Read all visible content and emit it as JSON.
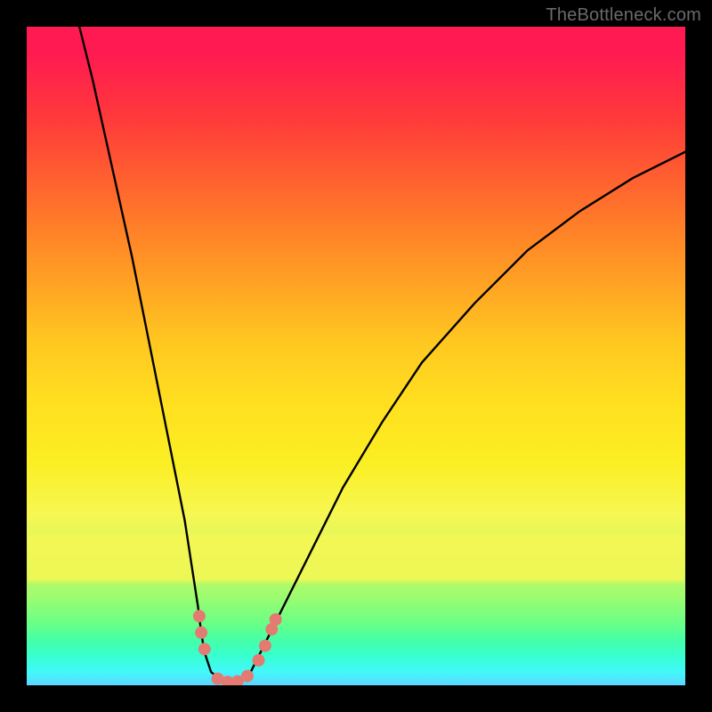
{
  "watermark": "TheBottleneck.com",
  "colors": {
    "curve": "#000000",
    "markers": "#e37b73",
    "frame": "#000000"
  },
  "chart_data": {
    "type": "line",
    "title": "",
    "xlabel": "",
    "ylabel": "",
    "xlim": [
      0,
      1
    ],
    "ylim": [
      0,
      1
    ],
    "grid": false,
    "legend": false,
    "series": [
      {
        "name": "curve",
        "x": [
          0.08,
          0.1,
          0.12,
          0.14,
          0.16,
          0.18,
          0.2,
          0.22,
          0.24,
          0.26,
          0.265,
          0.27,
          0.28,
          0.3,
          0.32,
          0.34,
          0.355,
          0.37,
          0.4,
          0.44,
          0.48,
          0.54,
          0.6,
          0.68,
          0.76,
          0.84,
          0.92,
          1.0
        ],
        "y": [
          1.0,
          0.92,
          0.83,
          0.74,
          0.65,
          0.55,
          0.45,
          0.35,
          0.25,
          0.12,
          0.08,
          0.05,
          0.02,
          0.005,
          0.005,
          0.02,
          0.05,
          0.08,
          0.14,
          0.22,
          0.3,
          0.4,
          0.49,
          0.58,
          0.66,
          0.72,
          0.77,
          0.81
        ]
      }
    ],
    "markers": [
      {
        "name": "marker-left-1",
        "x": 0.265,
        "y": 0.08
      },
      {
        "name": "marker-left-2",
        "x": 0.262,
        "y": 0.105
      },
      {
        "name": "marker-left-3",
        "x": 0.27,
        "y": 0.055
      },
      {
        "name": "marker-bottom-1",
        "x": 0.29,
        "y": 0.01
      },
      {
        "name": "marker-bottom-2",
        "x": 0.305,
        "y": 0.005
      },
      {
        "name": "marker-bottom-3",
        "x": 0.32,
        "y": 0.006
      },
      {
        "name": "marker-bottom-4",
        "x": 0.335,
        "y": 0.014
      },
      {
        "name": "marker-right-1",
        "x": 0.352,
        "y": 0.038
      },
      {
        "name": "marker-right-2",
        "x": 0.362,
        "y": 0.06
      },
      {
        "name": "marker-right-3",
        "x": 0.372,
        "y": 0.085
      },
      {
        "name": "marker-right-4",
        "x": 0.378,
        "y": 0.1
      }
    ]
  }
}
